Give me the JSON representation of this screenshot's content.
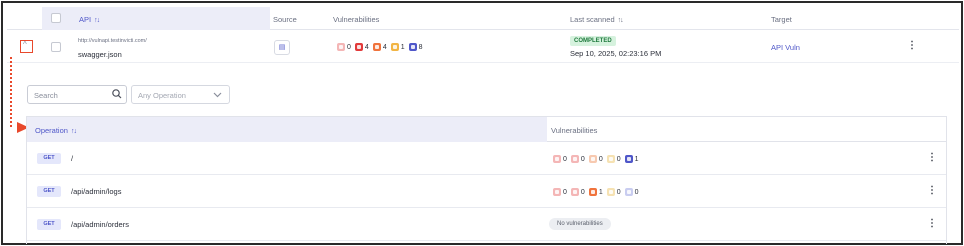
{
  "table": {
    "headers": {
      "api": "API",
      "api_sort": "↑↓",
      "source": "Source",
      "vulnerabilities": "Vulnerabilities",
      "last_scanned": "Last scanned",
      "last_scanned_sort": "↑↓",
      "target": "Target"
    },
    "row": {
      "expand_icon": "^",
      "url": "http://vulnapi.testinvicti.com/",
      "file": "swagger.json",
      "vulns": [
        "0",
        "4",
        "4",
        "1",
        "8"
      ],
      "status": "COMPLETED",
      "scanned": "Sep 10, 2025, 02:23:16 PM",
      "target": "API Vuln",
      "more_icon": "⋮"
    }
  },
  "filters": {
    "search_placeholder": "Search",
    "operation_placeholder": "Any Operation"
  },
  "operations": {
    "header_operation": "Operation",
    "header_sort": "↑↓",
    "header_vulnerabilities": "Vulnerabilities",
    "rows": [
      {
        "method": "GET",
        "path": "/",
        "vulns": [
          "0",
          "0",
          "0",
          "0",
          "1"
        ],
        "more": "⋮"
      },
      {
        "method": "GET",
        "path": "/api/admin/logs",
        "vulns": [
          "0",
          "0",
          "1",
          "0",
          "0"
        ],
        "more": "⋮"
      },
      {
        "method": "GET",
        "path": "/api/admin/orders",
        "no_vulns": "No vulnerabilities",
        "more": "⋮"
      }
    ]
  },
  "colors": {
    "critical": "#e23a3a",
    "high": "#f0733c",
    "medium": "#f2b544",
    "low": "#4f57c9",
    "info": "#6c7fd6",
    "accent": "#4f57c9",
    "annotation": "#e8492c"
  }
}
